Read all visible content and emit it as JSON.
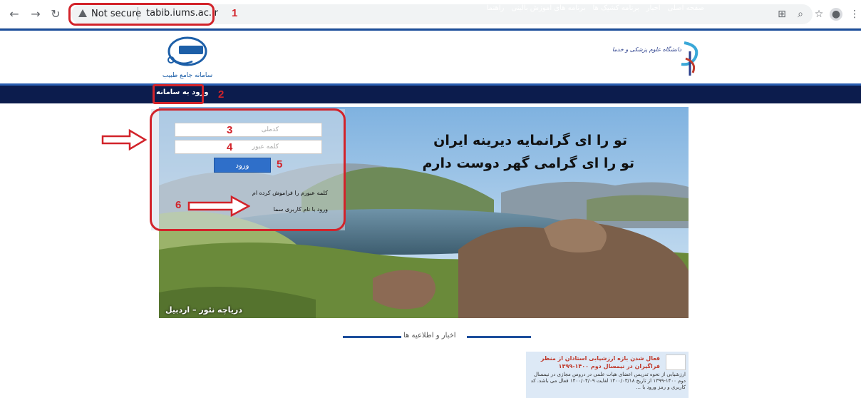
{
  "browser": {
    "security_label": "Not secure",
    "url": "tabib.iums.ac.ir"
  },
  "header": {
    "tabib_logo_text": "سامانه جامع طبیب",
    "university_logo_text": "دانشگاه علوم پزشکی و خدمات بهداشتی درمانی ایران"
  },
  "nav": {
    "login_link": "ورود به سامانه",
    "items": [
      "صفحه اصلی",
      "اخبار",
      "برنامه کشیک ها",
      "برنامه های آموزش بالینی",
      "راهنما"
    ]
  },
  "hero": {
    "slogan_line1": "تو را ای گرانمایه دیرینه ایران",
    "slogan_line2": "تو را ای گرامی گهر دوست دارم",
    "caption": "دریاچه نئور – اردبیل"
  },
  "login": {
    "username_placeholder": "کدملی",
    "password_placeholder": "کلمه عبور",
    "submit_label": "ورود",
    "forgot_password": "کلمه عبورم را فراموش کرده ام",
    "sama_login": "ورود با نام کاربری سما"
  },
  "annotations": [
    "1",
    "2",
    "3",
    "4",
    "5",
    "6"
  ],
  "news": {
    "section_title": "اخبار و اطلاعیه ها",
    "item_title": "فعال شدن بازه ارزشیابی استادان از منظر فراگیران در نیمسال دوم ۱۴۰۰-۱۳۹۹",
    "item_body": "ارزشیابی از نحوه تدریس اعضای هیات علمی در دروس مجازی در نیمسال دوم ۱۴۰۰-۱۳۹۹ از تاریخ ۱۴۰۰/۰۳/۱۸ لغایت ۱۴۰۰/۰۴/۰۹ فعال می باشد. کد کاربری و رمز ورود با ..."
  },
  "colors": {
    "annotation": "#d2232a",
    "navbar": "#0c1c4d",
    "accent": "#1d4f9c",
    "login_button": "#2f6fc9"
  }
}
